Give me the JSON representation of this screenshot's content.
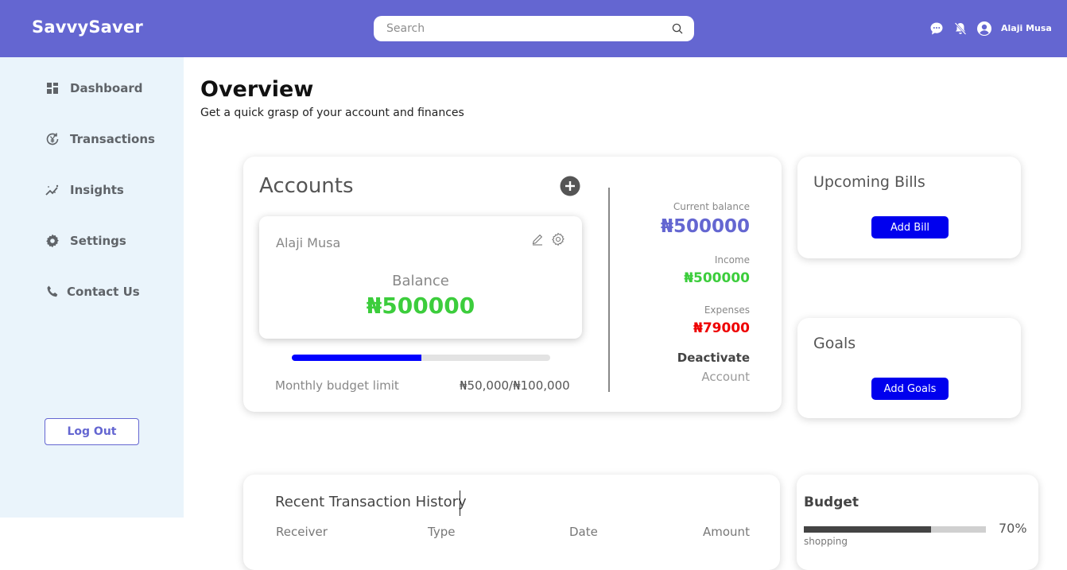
{
  "app": {
    "brand": "SavvySaver"
  },
  "header": {
    "search_placeholder": "Search",
    "user_name": "Alaji Musa"
  },
  "sidebar": {
    "items": [
      {
        "label": "Dashboard",
        "icon": "dashboard-icon"
      },
      {
        "label": "Transactions",
        "icon": "transactions-icon"
      },
      {
        "label": "Insights",
        "icon": "insights-icon"
      },
      {
        "label": "Settings",
        "icon": "gear-icon"
      },
      {
        "label": "Contact Us",
        "icon": "phone-icon"
      }
    ],
    "logout_label": "Log Out"
  },
  "main": {
    "title": "Overview",
    "subtitle": "Get a quick grasp of your account and finances"
  },
  "accounts": {
    "title": "Accounts",
    "holder": "Alaji Musa",
    "balance_label": "Balance",
    "balance_value": "₦500000",
    "budget_progress": 0.5,
    "budget_label": "Monthly budget limit",
    "budget_value": "₦50,000/₦100,000",
    "current_balance_label": "Current balance",
    "current_balance_value": "₦500000",
    "income_label": "Income",
    "income_value": "₦500000",
    "expenses_label": "Expenses",
    "expenses_value": "₦79000",
    "deactivate_line1": "Deactivate",
    "deactivate_line2": "Account"
  },
  "bills": {
    "title": "Upcoming Bills",
    "button": "Add Bill"
  },
  "goals": {
    "title": "Goals",
    "button": "Add Goals"
  },
  "transactions": {
    "title": "Recent Transaction History",
    "columns": [
      "Receiver",
      "Type",
      "Date",
      "Amount"
    ]
  },
  "budget": {
    "title": "Budget",
    "percent_label": "70%",
    "progress": 0.7,
    "category": "shopping"
  },
  "colors": {
    "header": "#6466d1",
    "sidebar": "#eaf4fb",
    "accent_blue": "#0000ee",
    "income_green": "#3ccd3c",
    "expense_red": "#ee0000"
  }
}
